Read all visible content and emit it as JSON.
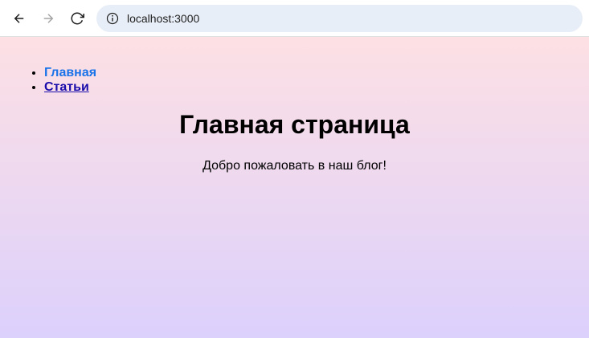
{
  "browser": {
    "url": "localhost:3000"
  },
  "nav": {
    "items": [
      {
        "label": "Главная",
        "active": true
      },
      {
        "label": "Статьи",
        "active": false
      }
    ]
  },
  "main": {
    "title": "Главная страница",
    "subtitle": "Добро пожаловать в наш блог!"
  },
  "colors": {
    "gradient_start": "#fde0e4",
    "gradient_end": "#dcd0fc",
    "link_active": "#1a73e8",
    "link_inactive": "#1a0dab"
  },
  "icons": {
    "back": "arrow-left-icon",
    "forward": "arrow-right-icon",
    "reload": "reload-icon",
    "info": "info-icon"
  }
}
